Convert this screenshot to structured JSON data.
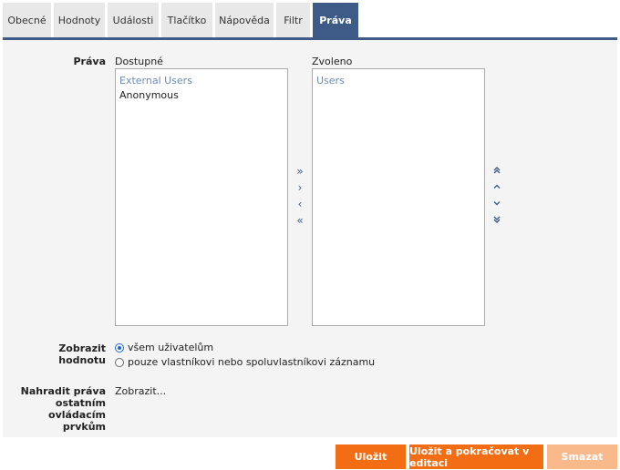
{
  "tabs": [
    {
      "label": "Obecné",
      "active": false
    },
    {
      "label": "Hodnoty",
      "active": false
    },
    {
      "label": "Události",
      "active": false
    },
    {
      "label": "Tlačítko",
      "active": false
    },
    {
      "label": "Nápověda",
      "active": false
    },
    {
      "label": "Filtr",
      "active": false
    },
    {
      "label": "Práva",
      "active": true
    }
  ],
  "rights": {
    "label": "Práva",
    "available_header": "Dostupné",
    "selected_header": "Zvoleno",
    "available": [
      "External Users",
      "Anonymous"
    ],
    "selected": [
      "Users"
    ]
  },
  "transfer_icons": {
    "add_all": "double-right-icon",
    "add": "right-icon",
    "remove": "left-icon",
    "remove_all": "double-left-icon"
  },
  "order_icons": {
    "top": "double-up-icon",
    "up": "up-icon",
    "down": "down-icon",
    "bottom": "double-down-icon"
  },
  "show_value": {
    "label": "Zobrazit hodnotu",
    "options": [
      "všem uživatelům",
      "pouze vlastníkovi nebo spoluvlastníkovi záznamu"
    ],
    "selected": "všem uživatelům"
  },
  "replace_rights": {
    "label_lines": [
      "Nahradit práva",
      "ostatním",
      "ovládacím",
      "prvkům"
    ],
    "link": "Zobrazit..."
  },
  "buttons": {
    "save": "Uložit",
    "save_continue": "Uložit a pokračovat v editaci",
    "delete": "Smazat"
  },
  "colors": {
    "accent": "#3e5b87",
    "button": "#f26d13",
    "button_disabled": "#f9b98b"
  }
}
